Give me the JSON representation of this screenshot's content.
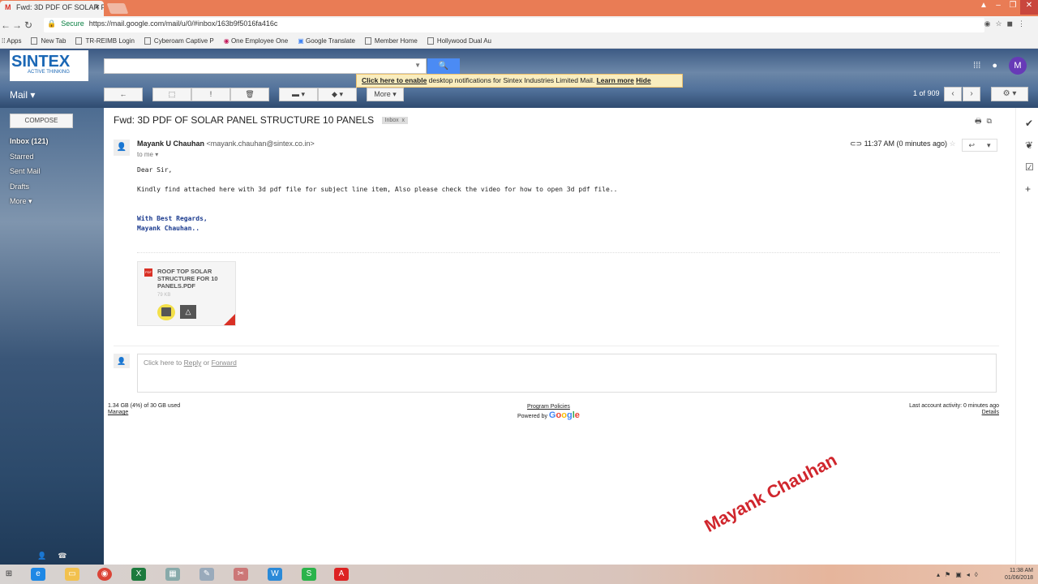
{
  "browser": {
    "tab_title": "Fwd: 3D PDF OF SOLAR P",
    "tab_favicon": "M",
    "tab_close": "×",
    "secure_label": "Secure",
    "url": "https://mail.google.com/mail/u/0/#inbox/163b9f5016fa416c",
    "bookmarks": [
      "Apps",
      "New Tab",
      "TR-REIMB Login",
      "Cyberoam Captive P",
      "One Employee One",
      "Google Translate",
      "Member Home",
      "Hollywood Dual Au"
    ]
  },
  "header": {
    "logo_text": "SINTEX",
    "logo_tagline": "ACTIVE THINKING",
    "account_initial": "M",
    "mail_label": "Mail ▾"
  },
  "notification": {
    "enable_link": "Click here to enable",
    "message": " desktop notifications for Sintex Industries Limited Mail.  ",
    "learn_more": "Learn more",
    "hide": "Hide"
  },
  "toolbar": {
    "back": "←",
    "archive": "⬚",
    "spam": "!",
    "delete": "🗑",
    "move": "▬ ▾",
    "labels": "◆ ▾",
    "more": "More ▾",
    "pager": "1 of 909",
    "prev": "‹",
    "next": "›",
    "settings": "⚙ ▾"
  },
  "sidebar": {
    "compose": "COMPOSE",
    "items": [
      "Inbox (121)",
      "Starred",
      "Sent Mail",
      "Drafts",
      "More ▾"
    ]
  },
  "email": {
    "subject": "Fwd: 3D PDF OF SOLAR PANEL STRUCTURE 10 PANELS",
    "label": "Inbox",
    "label_close": "x",
    "sender_name": "Mayank U Chauhan",
    "sender_email": " <mayank.chauhan@sintex.co.in>",
    "to": "to me ▾",
    "time": "11:37 AM (0 minutes ago)",
    "greeting": "Dear Sir,",
    "body": "Kindly find attached here with 3d pdf file for subject line item, Also please check the video for how to open 3d pdf file..",
    "sig1": "With Best Regards,",
    "sig2": "Mayank Chauhan..",
    "attachment_name": "ROOF TOP SOLAR STRUCTURE FOR 10 PANELS.PDF",
    "attachment_size": "79 KB",
    "pdf_badge": "PDF"
  },
  "reply": {
    "prefix": "Click here to ",
    "reply": "Reply",
    "or": " or ",
    "forward": "Forward"
  },
  "footer": {
    "storage": "1.34 GB (4%) of 30 GB used",
    "manage": "Manage",
    "policies": "Program Policies",
    "powered": "Powered by ",
    "google": "Google",
    "activity": "Last account activity: 0 minutes ago",
    "details": "Details"
  },
  "watermark": "Mayank Chauhan",
  "taskbar": {
    "time": "11:38 AM",
    "date": "01/06/2018"
  }
}
